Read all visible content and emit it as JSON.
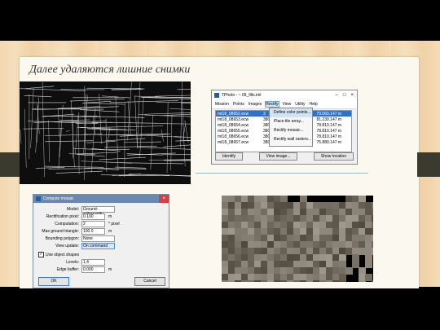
{
  "slide": {
    "title": "Далее удаляются лишние снимки"
  },
  "tphoto": {
    "title": "TPhoto - ~ 09_filts.iml",
    "window_buttons": [
      "–",
      "□",
      "×"
    ],
    "menu": [
      "Mission",
      "Points",
      "Images",
      "Rectify",
      "View",
      "Utility",
      "Help"
    ],
    "active_menu": "Rectify",
    "rows": [
      {
        "file": "mt18_08652.ecw",
        "c2": "3",
        "c3": "79.06",
        "c4": "0.147 m"
      },
      {
        "file": "mt18_08653.ecw",
        "c2": "380",
        "c3": "81.23",
        "c4": "0.147 m"
      },
      {
        "file": "mt18_08654.ecw",
        "c2": "380",
        "c3": "78.81",
        "c4": "0.147 m"
      },
      {
        "file": "mt18_08655.ecw",
        "c2": "380",
        "c3": "78.81",
        "c4": "0.147 m"
      },
      {
        "file": "mt18_08656.ecw",
        "c2": "380",
        "c3": "78.81",
        "c4": "0.147 m"
      },
      {
        "file": "mt18_08657.ecw",
        "c2": "380",
        "c3": "75.88",
        "c4": "0.147 m"
      }
    ],
    "dropdown": [
      "Define color points...",
      "Place tile array...",
      "Rectify mosaic...",
      "Rectify wall rasters..."
    ],
    "buttons": {
      "identify": "Identify",
      "view_image": "View image...",
      "show_location": "Show location"
    }
  },
  "dialog": {
    "title": "Compute mosaic",
    "close": "×",
    "fields": {
      "model_label": "Model:",
      "model_value": "Ground-orthorectify",
      "pixel_label": "Rectification pixel:",
      "pixel_value": "0.100",
      "pixel_unit": "m",
      "comp_label": "Computation:",
      "comp_value": "2",
      "comp_unit": "* pixel",
      "tri_label": "Max ground triangle:",
      "tri_value": "100.0",
      "tri_unit": "m",
      "poly_label": "Bounding polygon:",
      "poly_value": "None",
      "update_label": "View update:",
      "update_value": "On command"
    },
    "use_shapes": "Use object shapes",
    "levels_label": "Levels:",
    "levels_value": "1,4",
    "edge_label": "Edge buffer:",
    "edge_value": "0.000",
    "edge_unit": "m",
    "ok": "OK",
    "cancel": "Cancel"
  }
}
